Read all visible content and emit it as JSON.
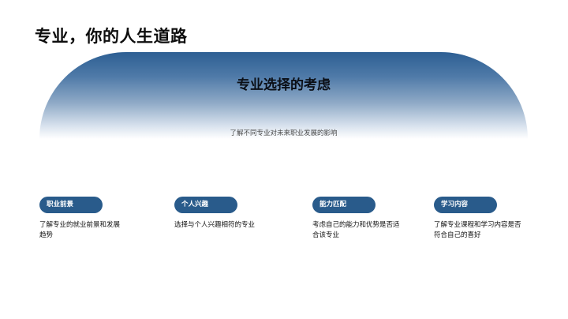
{
  "page": {
    "title": "专业，你的人生道路"
  },
  "hero": {
    "title": "专业选择的考虑",
    "subtitle": "了解不同专业对未来职业发展的影响"
  },
  "cards": [
    {
      "tag": "职业前景",
      "description": "了解专业的就业前景和发展趋势"
    },
    {
      "tag": "个人兴趣",
      "description": "选择与个人兴趣相符的专业"
    },
    {
      "tag": "能力匹配",
      "description": "考虑自己的能力和优势是否适合该专业"
    },
    {
      "tag": "学习内容",
      "description": "了解专业课程和学习内容是否符合自己的喜好"
    }
  ],
  "colors": {
    "accent": "#295b8b",
    "hero_top": "#2d5f93"
  }
}
